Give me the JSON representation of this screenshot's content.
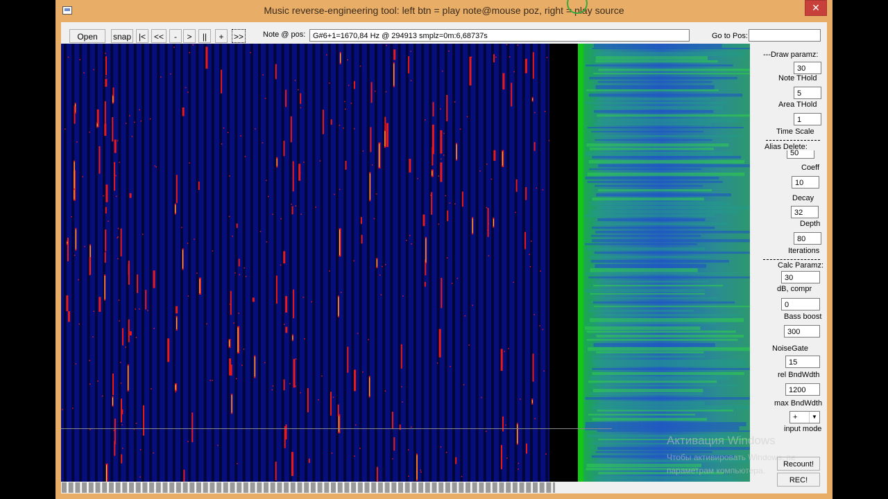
{
  "window": {
    "title": "Music reverse-engineering tool: left btn = play note@mouse poz, right = play source",
    "close_label": "✕"
  },
  "toolbar": {
    "open": "Open",
    "snap": "snap",
    "to_start": "|<",
    "rewind": "<<",
    "minus": "-",
    "play": ">",
    "pause": "||",
    "plus": "+",
    "forward": ">>",
    "note_label": "Note @ pos:",
    "note_value": "G#6+1=1670,84 Hz         @  294913 smplz=0m:6,68737s",
    "goto_label": "Go to Pos:",
    "goto_value": ""
  },
  "right_panel": {
    "draw_header": "---Draw paramz:",
    "note_thold_value": "30",
    "note_thold_label": "Note THold",
    "area_thold_value": "5",
    "area_thold_label": "Area THold",
    "time_scale_value": "1",
    "time_scale_label": "Time Scale",
    "alias_header": "Alias Delete:",
    "coeff_value": "50",
    "coeff_label": "Coeff",
    "decay_value": "10",
    "decay_label": "Decay",
    "depth_value": "32",
    "depth_label": "Depth",
    "iterations_value": "80",
    "iterations_label": "Iterations",
    "calc_header": "Calc Paramz:",
    "db_compr_value": "30",
    "db_compr_label": "dB, compr",
    "bass_boost_value": "0",
    "bass_boost_label": "Bass boost",
    "noise_gate_value": "300",
    "noise_gate_label": "NoiseGate",
    "rel_bw_value": "15",
    "rel_bw_label": "rel BndWdth",
    "max_bw_value": "1200",
    "max_bw_label": "max BndWdth",
    "input_mode_value": "+",
    "input_mode_label": "input mode",
    "recount": "Recount!",
    "rec": "REC!"
  },
  "watermark": {
    "title": "Активация Windows",
    "line1": "Чтобы активировать Windows, пе",
    "line2": "параметрам компьютера."
  },
  "colors": {
    "title_bar": "#e8ae68",
    "spectrogram_bg": "#060e7c",
    "note_red": "#e81a1a",
    "note_yellow": "#ffd23a",
    "panel_green": "#15c815",
    "panel_blue": "#2466b8"
  },
  "icons": {
    "app": "app-window-icon",
    "close": "close-icon",
    "dropdown": "chevron-down-icon"
  }
}
